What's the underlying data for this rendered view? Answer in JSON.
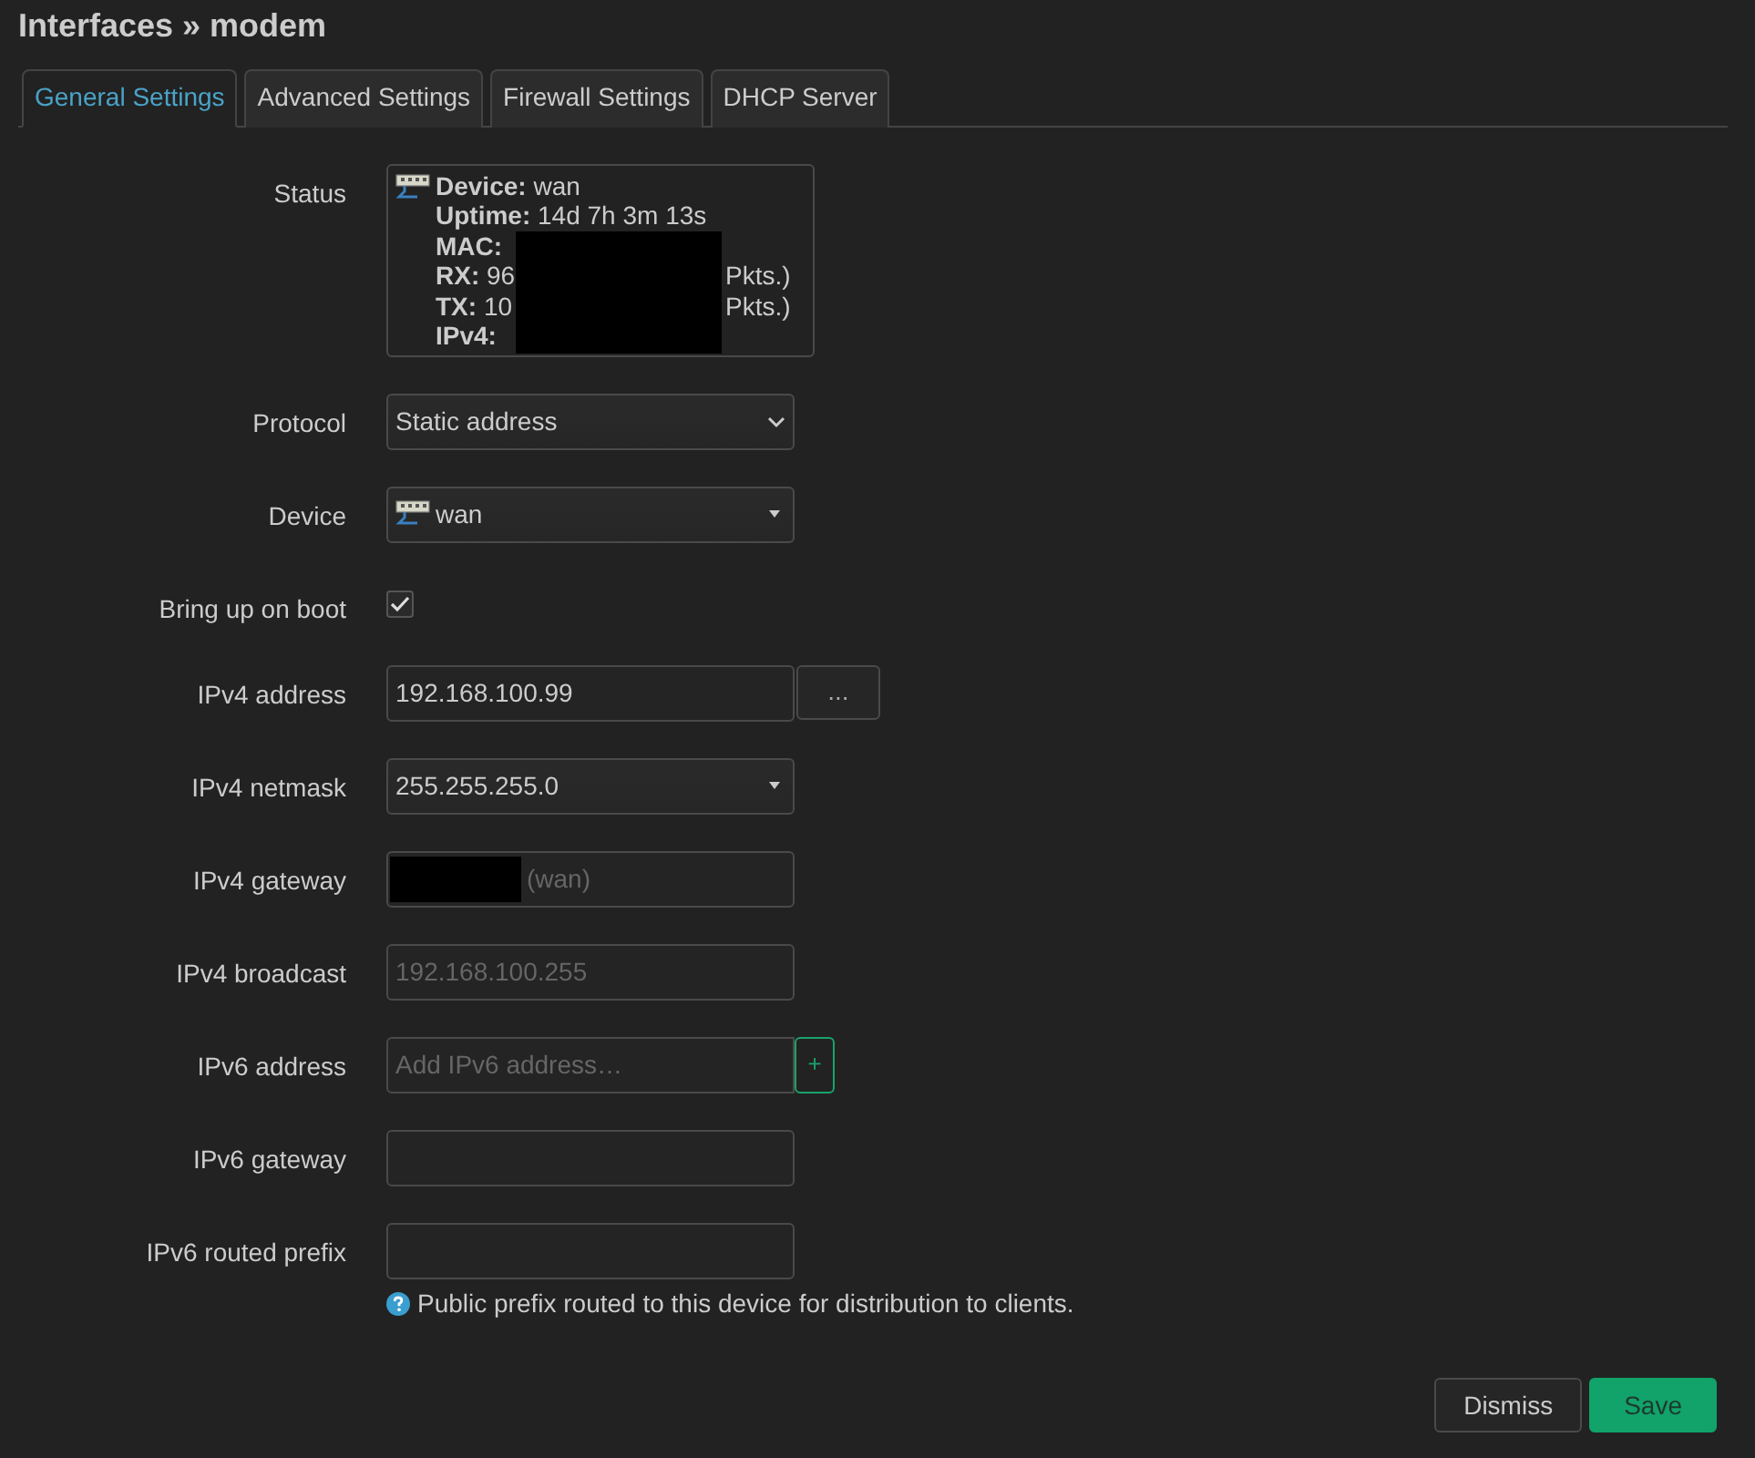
{
  "title": "Interfaces » modem",
  "tabs": [
    {
      "label": "General Settings",
      "selected": true
    },
    {
      "label": "Advanced Settings",
      "selected": false
    },
    {
      "label": "Firewall Settings",
      "selected": false
    },
    {
      "label": "DHCP Server",
      "selected": false
    }
  ],
  "status": {
    "label": "Status",
    "lines": [
      {
        "label": "Device:",
        "value": "wan"
      },
      {
        "label": "Uptime:",
        "value": "14d 7h 3m 13s"
      },
      {
        "label": "MAC:"
      },
      {
        "label": "RX:",
        "value": "96",
        "suffix": "Pkts.)"
      },
      {
        "label": "TX:",
        "value": "10",
        "suffix": "Pkts.)"
      },
      {
        "label": "IPv4:"
      }
    ]
  },
  "fields": [
    {
      "kind": "select",
      "label": "Protocol",
      "value": "Static address"
    },
    {
      "kind": "device",
      "label": "Device",
      "value": "wan"
    },
    {
      "kind": "checkbox",
      "label": "Bring up on boot",
      "checked": true
    },
    {
      "kind": "text",
      "label": "IPv4 address",
      "value": "192.168.100.99",
      "button": "..."
    },
    {
      "kind": "dropdown",
      "label": "IPv4 netmask",
      "value": "255.255.255.0"
    },
    {
      "kind": "redacted",
      "label": "IPv4 gateway",
      "placeholder": "(wan)"
    },
    {
      "kind": "text",
      "label": "IPv4 broadcast",
      "placeholder": "192.168.100.255"
    },
    {
      "kind": "add",
      "label": "IPv6 address",
      "placeholder": "Add IPv6 address…",
      "button": "+"
    },
    {
      "kind": "text",
      "label": "IPv6 gateway"
    },
    {
      "kind": "text",
      "label": "IPv6 routed prefix",
      "help": "Public prefix routed to this device for distribution to clients."
    }
  ],
  "buttons": [
    {
      "label": "Dismiss",
      "kind": "secondary"
    },
    {
      "label": "Save",
      "kind": "primary"
    }
  ]
}
